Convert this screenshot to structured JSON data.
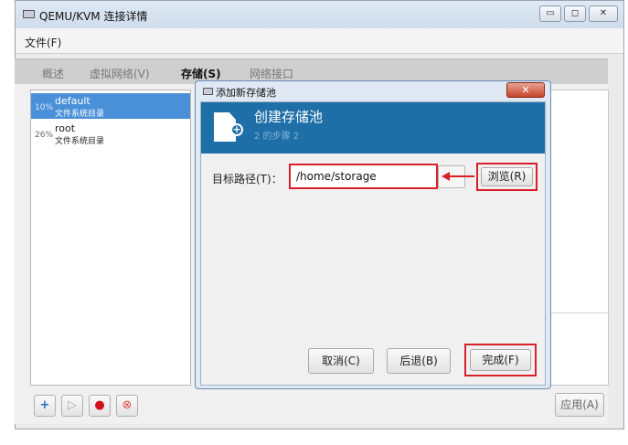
{
  "window": {
    "title": "QEMU/KVM 连接详情",
    "min_label": "▭",
    "max_label": "◻",
    "close_label": "✕"
  },
  "menu": {
    "file": "文件(F)"
  },
  "tabs": [
    {
      "label": "概述"
    },
    {
      "label": "虚拟网络(V)"
    },
    {
      "label": "存储(S)"
    },
    {
      "label": "网络接口"
    }
  ],
  "pools": [
    {
      "percent": "10%",
      "name": "default",
      "type": "文件系统目录"
    },
    {
      "percent": "26%",
      "name": "root",
      "type": "文件系统目录"
    }
  ],
  "toolbar": {
    "add": "+",
    "start": "▷",
    "stop": "●",
    "delete": "⊗",
    "apply": "应用(A)"
  },
  "dialog": {
    "title": "添加新存储池",
    "close": "✕",
    "header_title": "创建存储池",
    "header_step": "2 的步骤 2",
    "target_label": "目标路径(T)：",
    "target_value": "/home/storage",
    "browse": "浏览(R)",
    "cancel": "取消(C)",
    "back": "后退(B)",
    "finish": "完成(F)"
  },
  "colors": {
    "accent": "#1e6fa8",
    "highlight": "#d8202a",
    "selection": "#4a90d9"
  }
}
